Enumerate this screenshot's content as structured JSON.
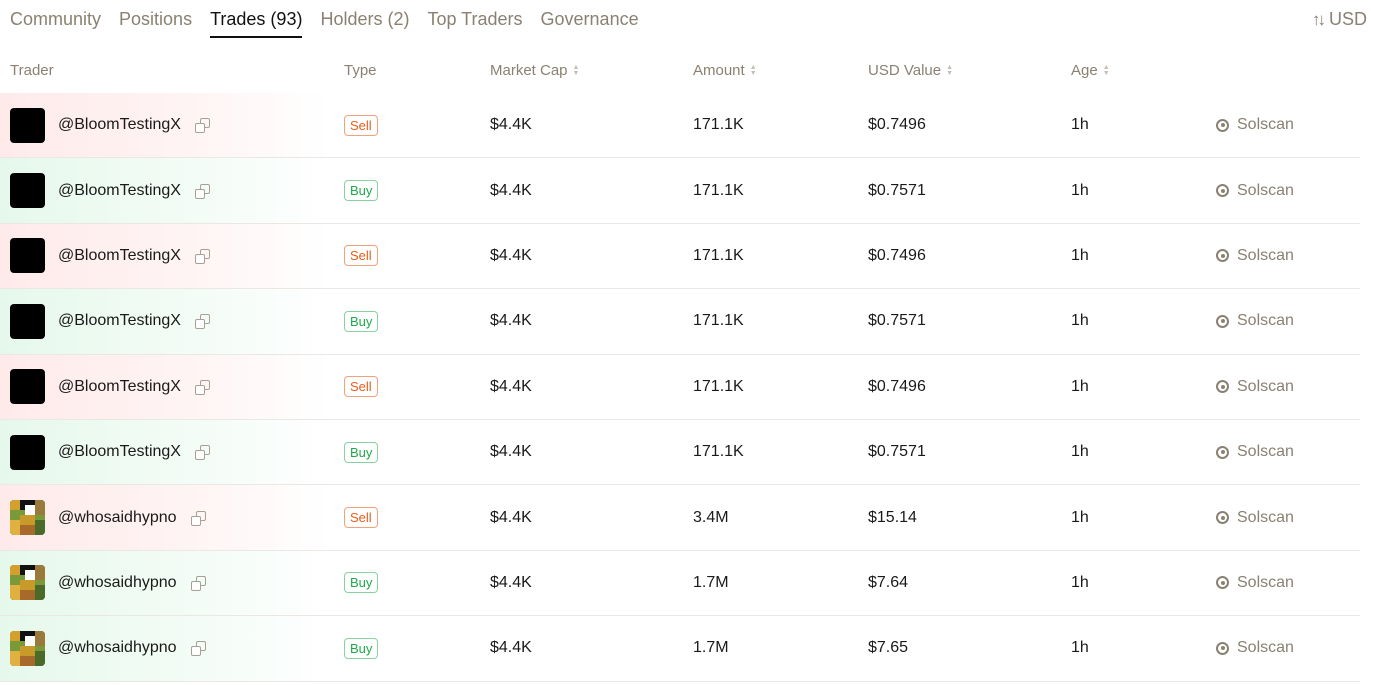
{
  "tabs": [
    {
      "label": "Community"
    },
    {
      "label": "Positions"
    },
    {
      "label": "Trades (93)",
      "active": true
    },
    {
      "label": "Holders (2)"
    },
    {
      "label": "Top Traders"
    },
    {
      "label": "Governance"
    }
  ],
  "currency": {
    "label": "USD",
    "icon": "swap-vertical-icon"
  },
  "table": {
    "columns": [
      {
        "label": "Trader",
        "sortable": false
      },
      {
        "label": "Type",
        "sortable": false
      },
      {
        "label": "Market Cap",
        "sortable": true
      },
      {
        "label": "Amount",
        "sortable": true
      },
      {
        "label": "USD Value",
        "sortable": true
      },
      {
        "label": "Age",
        "sortable": true
      }
    ],
    "rows": [
      {
        "trader": "@BloomTestingX",
        "avatar": "black",
        "type": "Sell",
        "market_cap": "$4.4K",
        "amount": "171.1K",
        "usd_value": "$0.7496",
        "age": "1h",
        "link": "Solscan"
      },
      {
        "trader": "@BloomTestingX",
        "avatar": "black",
        "type": "Buy",
        "market_cap": "$4.4K",
        "amount": "171.1K",
        "usd_value": "$0.7571",
        "age": "1h",
        "link": "Solscan"
      },
      {
        "trader": "@BloomTestingX",
        "avatar": "black",
        "type": "Sell",
        "market_cap": "$4.4K",
        "amount": "171.1K",
        "usd_value": "$0.7496",
        "age": "1h",
        "link": "Solscan"
      },
      {
        "trader": "@BloomTestingX",
        "avatar": "black",
        "type": "Buy",
        "market_cap": "$4.4K",
        "amount": "171.1K",
        "usd_value": "$0.7571",
        "age": "1h",
        "link": "Solscan"
      },
      {
        "trader": "@BloomTestingX",
        "avatar": "black",
        "type": "Sell",
        "market_cap": "$4.4K",
        "amount": "171.1K",
        "usd_value": "$0.7496",
        "age": "1h",
        "link": "Solscan"
      },
      {
        "trader": "@BloomTestingX",
        "avatar": "black",
        "type": "Buy",
        "market_cap": "$4.4K",
        "amount": "171.1K",
        "usd_value": "$0.7571",
        "age": "1h",
        "link": "Solscan"
      },
      {
        "trader": "@whosaidhypno",
        "avatar": "pixel",
        "type": "Sell",
        "market_cap": "$4.4K",
        "amount": "3.4M",
        "usd_value": "$15.14",
        "age": "1h",
        "link": "Solscan"
      },
      {
        "trader": "@whosaidhypno",
        "avatar": "pixel",
        "type": "Buy",
        "market_cap": "$4.4K",
        "amount": "1.7M",
        "usd_value": "$7.64",
        "age": "1h",
        "link": "Solscan"
      },
      {
        "trader": "@whosaidhypno",
        "avatar": "pixel",
        "type": "Buy",
        "market_cap": "$4.4K",
        "amount": "1.7M",
        "usd_value": "$7.65",
        "age": "1h",
        "link": "Solscan"
      }
    ]
  },
  "colors": {
    "sell": "#e85d1a",
    "buy": "#1fa94a",
    "muted": "#8a8172"
  }
}
